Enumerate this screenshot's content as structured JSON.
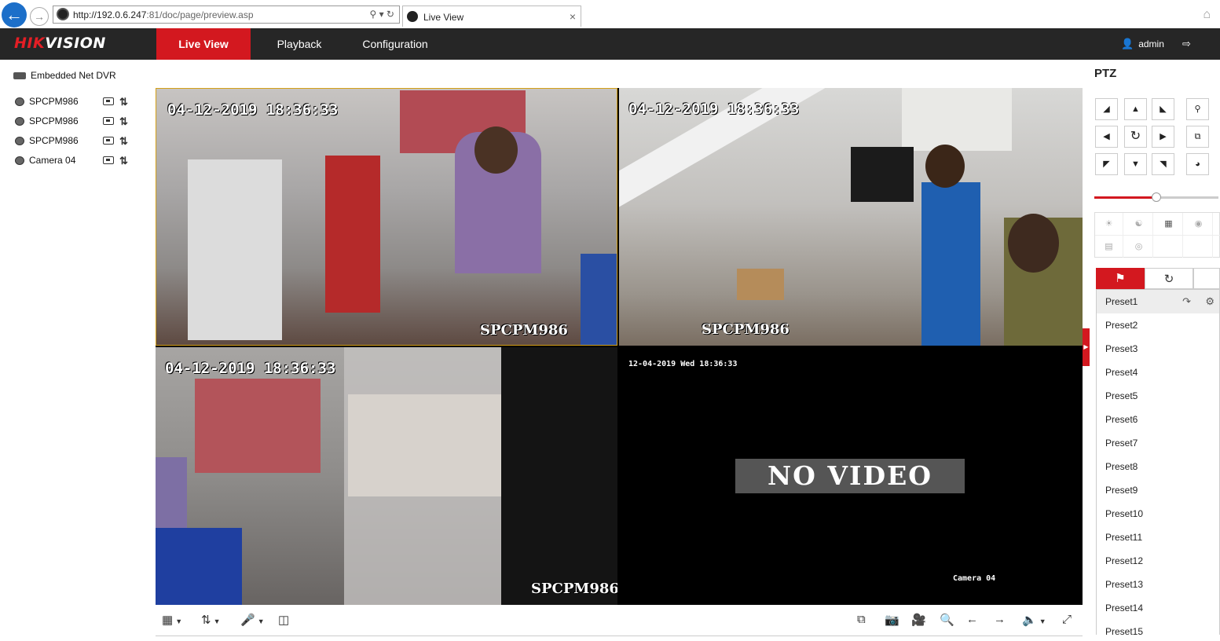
{
  "browser": {
    "url_host": "http://192.0.6.247",
    "url_rest": ":81/doc/page/preview.asp",
    "tab_label": "Live View",
    "close_glyph": "×"
  },
  "header": {
    "logo_part1": "HIK",
    "logo_part2": "VISION",
    "nav": [
      "Live View",
      "Playback",
      "Configuration"
    ],
    "user": "admin",
    "logout": "Logout"
  },
  "tree": {
    "root": "Embedded Net DVR",
    "cameras": [
      "SPCPM986",
      "SPCPM986",
      "SPCPM986",
      "Camera 04"
    ]
  },
  "video": {
    "cells": [
      {
        "time": "04-12-2019 18:36:33",
        "name": "SPCPM986"
      },
      {
        "time": "04-12-2019 18:36:33",
        "name": "SPCPM986"
      },
      {
        "time": "04-12-2019 18:36:33",
        "name": "SPCPM986"
      },
      {
        "time": "12-04-2019 Wed 18:36:33",
        "name": "Camera 04",
        "status": "NO VIDEO"
      }
    ]
  },
  "ptz": {
    "title": "PTZ",
    "speed_level": 0.5,
    "presets": [
      "Preset1",
      "Preset2",
      "Preset3",
      "Preset4",
      "Preset5",
      "Preset6",
      "Preset7",
      "Preset8",
      "Preset9",
      "Preset10",
      "Preset11",
      "Preset12",
      "Preset13",
      "Preset14",
      "Preset15"
    ]
  },
  "colors": {
    "accent": "#d3181f",
    "topbar": "#262626"
  }
}
